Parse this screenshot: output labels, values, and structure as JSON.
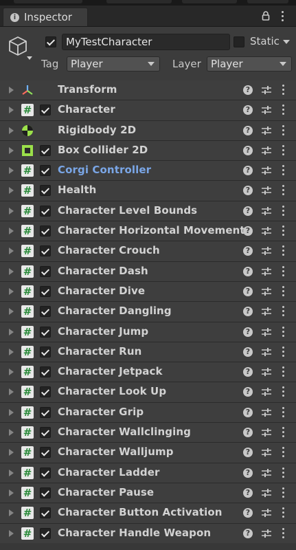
{
  "window": {
    "tab_title": "Inspector"
  },
  "gameobject": {
    "active": true,
    "name": "MyTestCharacter",
    "static_label": "Static",
    "static_checked": false,
    "tag_label": "Tag",
    "tag_value": "Player",
    "layer_label": "Layer",
    "layer_value": "Player"
  },
  "components": [
    {
      "name": "Transform",
      "icon": "transform-icon",
      "has_checkbox": false,
      "checked": false
    },
    {
      "name": "Character",
      "icon": "script-icon",
      "has_checkbox": true,
      "checked": true
    },
    {
      "name": "Rigidbody 2D",
      "icon": "rigidbody2d-icon",
      "has_checkbox": false,
      "checked": false
    },
    {
      "name": "Box Collider 2D",
      "icon": "boxcollider2d-icon",
      "has_checkbox": true,
      "checked": true
    },
    {
      "name": "Corgi Controller",
      "icon": "script-icon",
      "has_checkbox": true,
      "checked": true,
      "highlight": true
    },
    {
      "name": "Health",
      "icon": "script-icon",
      "has_checkbox": true,
      "checked": true
    },
    {
      "name": "Character Level Bounds",
      "icon": "script-icon",
      "has_checkbox": true,
      "checked": true
    },
    {
      "name": "Character Horizontal Movement",
      "icon": "script-icon",
      "has_checkbox": true,
      "checked": true
    },
    {
      "name": "Character Crouch",
      "icon": "script-icon",
      "has_checkbox": true,
      "checked": true
    },
    {
      "name": "Character Dash",
      "icon": "script-icon",
      "has_checkbox": true,
      "checked": true
    },
    {
      "name": "Character Dive",
      "icon": "script-icon",
      "has_checkbox": true,
      "checked": true
    },
    {
      "name": "Character Dangling",
      "icon": "script-icon",
      "has_checkbox": true,
      "checked": true
    },
    {
      "name": "Character Jump",
      "icon": "script-icon",
      "has_checkbox": true,
      "checked": true
    },
    {
      "name": "Character Run",
      "icon": "script-icon",
      "has_checkbox": true,
      "checked": true
    },
    {
      "name": "Character Jetpack",
      "icon": "script-icon",
      "has_checkbox": true,
      "checked": true
    },
    {
      "name": "Character Look Up",
      "icon": "script-icon",
      "has_checkbox": true,
      "checked": true
    },
    {
      "name": "Character Grip",
      "icon": "script-icon",
      "has_checkbox": true,
      "checked": true
    },
    {
      "name": "Character Wallclinging",
      "icon": "script-icon",
      "has_checkbox": true,
      "checked": true
    },
    {
      "name": "Character Walljump",
      "icon": "script-icon",
      "has_checkbox": true,
      "checked": true
    },
    {
      "name": "Character Ladder",
      "icon": "script-icon",
      "has_checkbox": true,
      "checked": true
    },
    {
      "name": "Character Pause",
      "icon": "script-icon",
      "has_checkbox": true,
      "checked": true
    },
    {
      "name": "Character Button Activation",
      "icon": "script-icon",
      "has_checkbox": true,
      "checked": true
    },
    {
      "name": "Character Handle Weapon",
      "icon": "script-icon",
      "has_checkbox": true,
      "checked": true
    }
  ],
  "colors": {
    "highlight_text": "#7aa6e6",
    "script_icon_hash": "#2a8a3a",
    "rigidbody_green": "#9be04a"
  }
}
